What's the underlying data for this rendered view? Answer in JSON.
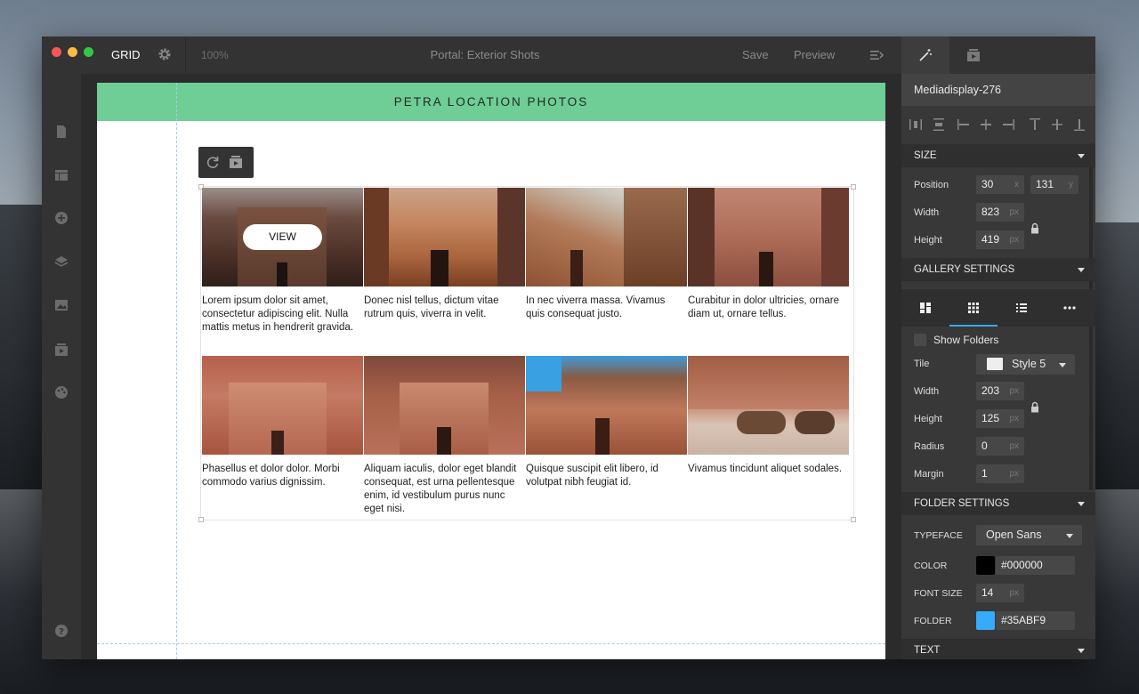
{
  "window": {
    "app_name": "GRID",
    "zoom": "100%",
    "document_title": "Portal: Exterior Shots",
    "save_label": "Save",
    "preview_label": "Preview",
    "traffic_lights": [
      "#fc5753",
      "#fdbc40",
      "#33c748"
    ]
  },
  "left_rail": {
    "top_icons": [
      "page-icon",
      "layout-icon",
      "add-icon",
      "layers-icon",
      "image-icon",
      "media-icon",
      "palette-icon"
    ],
    "bottom_icons": [
      "help-icon",
      "logout-icon"
    ]
  },
  "page": {
    "banner_title": "PETRA LOCATION PHOTOS",
    "banner_color": "#6fcd96",
    "gallery": {
      "view_label": "VIEW",
      "tiles": [
        {
          "caption": "Lorem ipsum dolor sit amet, consectetur adipiscing elit. Nulla mattis metus in hendrerit gravida.",
          "tone": "dark"
        },
        {
          "caption": "Donec nisl tellus, dictum vitae rutrum quis, viverra in velit.",
          "tone": "warm"
        },
        {
          "caption": "In nec viverra massa. Vivamus quis consequat justo.",
          "tone": "sky"
        },
        {
          "caption": "Curabitur in dolor ultricies, ornare diam ut, ornare tellus.",
          "tone": "rose"
        },
        {
          "caption": "Phasellus et dolor dolor. Morbi commodo varius dignissim.",
          "tone": "rose"
        },
        {
          "caption": "Aliquam iaculis, dolor eget blandit consequat, est urna pellentesque enim, id vestibulum purus nunc eget nisi.",
          "tone": "red"
        },
        {
          "caption": "Quisque suscipit elit libero, id volutpat nibh feugiat id.",
          "tone": "sky"
        },
        {
          "caption": "Vivamus tincidunt aliquet sodales.",
          "tone": "camel"
        }
      ]
    }
  },
  "panel": {
    "component_name": "Mediadisplay-276",
    "size": {
      "title": "SIZE",
      "position_label": "Position",
      "pos_x": "30",
      "pos_x_unit": "x",
      "pos_y": "131",
      "pos_y_unit": "y",
      "width_label": "Width",
      "width": "823",
      "width_unit": "px",
      "height_label": "Height",
      "height": "419",
      "height_unit": "px"
    },
    "gallery_settings": {
      "title": "GALLERY SETTINGS",
      "show_folders_label": "Show Folders",
      "tile_label": "Tile",
      "tile_style": "Style 5",
      "width_label": "Width",
      "width": "203",
      "width_unit": "px",
      "height_label": "Height",
      "height": "125",
      "height_unit": "px",
      "radius_label": "Radius",
      "radius": "0",
      "radius_unit": "px",
      "margin_label": "Margin",
      "margin": "1",
      "margin_unit": "px"
    },
    "folder_settings": {
      "title": "FOLDER SETTINGS",
      "typeface_label": "TYPEFACE",
      "typeface": "Open Sans",
      "color_label": "COLOR",
      "color": "#000000",
      "font_size_label": "FONT SIZE",
      "font_size": "14",
      "font_size_unit": "px",
      "folder_label": "FOLDER",
      "folder_color": "#35ABF9"
    },
    "text_section": "TEXT"
  }
}
